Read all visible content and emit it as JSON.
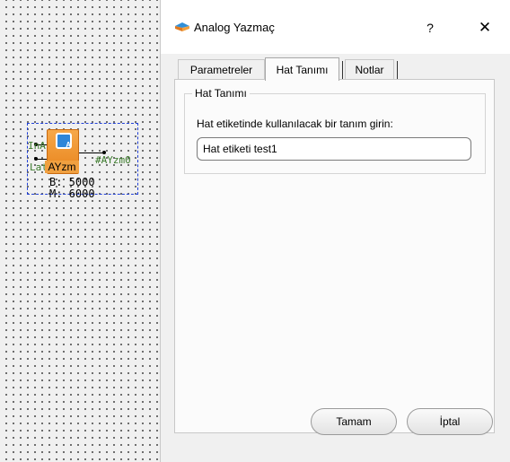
{
  "canvas": {
    "block": {
      "name": "AYzm",
      "inputs": [
        "InA",
        "Lat"
      ],
      "output": "#AYzm0",
      "param_b": "B: 5000",
      "param_m": "M: 6000"
    }
  },
  "dialog": {
    "title": "Analog Yazmaç",
    "help_label": "?",
    "close_label": "✕",
    "tabs": [
      {
        "label": "Parametreler",
        "active": false
      },
      {
        "label": "Hat Tanımı",
        "active": true
      },
      {
        "label": "Notlar",
        "active": false
      }
    ],
    "group": {
      "title": "Hat Tanımı",
      "instruction": "Hat etiketinde kullanılacak bir tanım girin:",
      "input_value": "Hat etiketi test1"
    },
    "buttons": {
      "ok": "Tamam",
      "cancel": "İptal"
    }
  },
  "colors": {
    "selection": "#2040d8",
    "block_fill": "#e8841c",
    "block_icon": "#2f86d8",
    "port_label": "#3a7a2a"
  }
}
